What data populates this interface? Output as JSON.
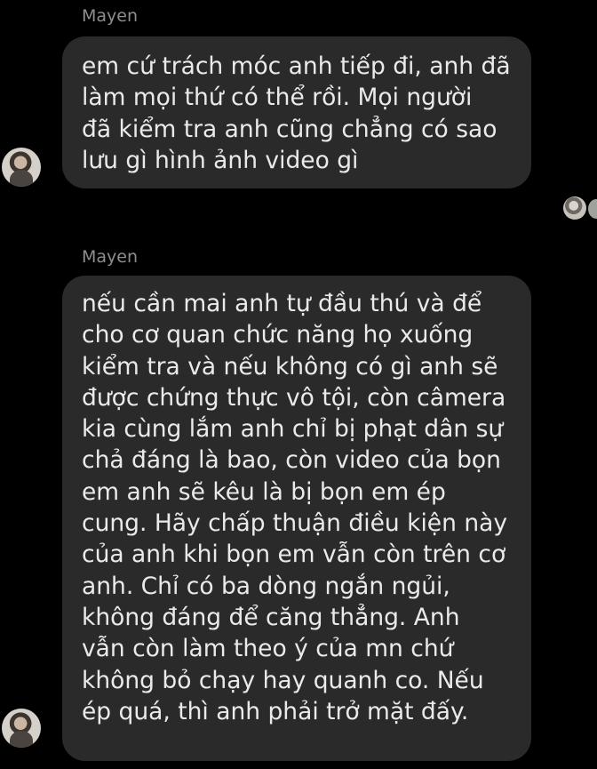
{
  "messages": [
    {
      "sender": "Mayen",
      "text": "em cứ trách móc anh tiếp đi, anh đã\nlàm mọi thứ có thể rồi. Mọi người\nđã kiểm tra anh cũng chẳng có sao\nlưu gì hình ảnh video gì"
    },
    {
      "sender": "Mayen",
      "text": "nếu cần mai anh tự đầu thú và để\ncho cơ quan chức năng họ xuống\nkiểm tra và nếu không có gì anh sẽ\nđược chứng thực vô tội, còn câmera\nkia cùng lắm anh chỉ bị phạt dân sự\nchả đáng là bao, còn video của bọn\nem anh sẽ kêu là bị bọn em ép\ncung. Hãy chấp thuận điều kiện này\ncủa anh khi bọn em vẫn còn trên cơ\nanh. Chỉ có ba dòng ngắn ngủi,\nkhông đáng để căng thẳng. Anh\nvẫn còn làm theo ý của mn chứ\nkhông bỏ chạy hay quanh co. Nếu\nép quá, thì anh phải trở mặt đấy."
    }
  ],
  "icons": {
    "sender_avatar": "avatar",
    "read_receipt": "read-receipt-avatar"
  },
  "colors": {
    "background": "#000000",
    "bubble": "#2a2a2a",
    "text": "#eaeaea",
    "sender_name": "#8e8e8e"
  }
}
